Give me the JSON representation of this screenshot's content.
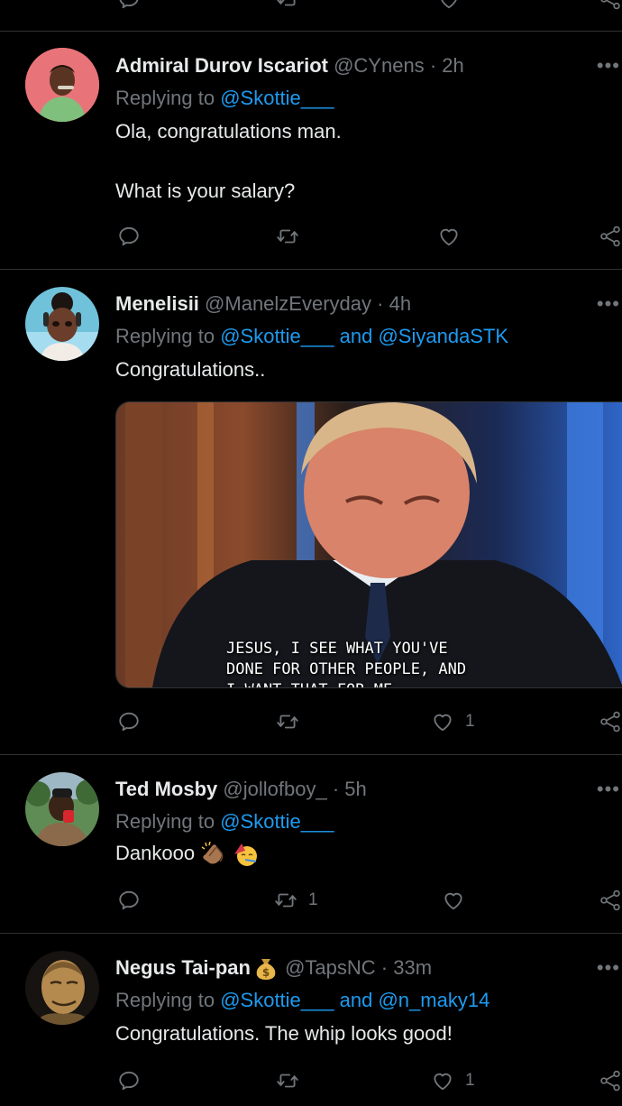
{
  "tweets": [
    {
      "name": "Admiral Durov Iscariot",
      "handle": "@CYnens",
      "dot": "·",
      "time": "2h",
      "replying_prefix": "Replying to",
      "mentions": [
        "@Skottie___"
      ],
      "text_lines": [
        "Ola, congratulations man.",
        "What is your salary?"
      ],
      "retweets": "",
      "likes": ""
    },
    {
      "name": "Menelisii",
      "handle": "@ManelzEveryday",
      "dot": "·",
      "time": "4h",
      "replying_prefix": "Replying to",
      "mentions": [
        "@Skottie___",
        "@SiyandaSTK"
      ],
      "conjunction": "and",
      "text_lines": [
        "Congratulations.."
      ],
      "media_caption": "JESUS, I SEE WHAT YOU'VE\nDONE FOR OTHER PEOPLE, AND\nI WANT THAT FOR ME.",
      "retweets": "",
      "likes": "1"
    },
    {
      "name": "Ted Mosby",
      "handle": "@jollofboy_",
      "dot": "·",
      "time": "5h",
      "replying_prefix": "Replying to",
      "mentions": [
        "@Skottie___"
      ],
      "text_lines": [
        "Dankooo"
      ],
      "retweets": "1",
      "likes": ""
    },
    {
      "name": "Negus Tai-pan",
      "handle": "@TapsNC",
      "dot": "·",
      "time": "33m",
      "replying_prefix": "Replying to",
      "mentions": [
        "@Skottie___",
        "@n_maky14"
      ],
      "conjunction": "and",
      "text_lines": [
        "Congratulations. The whip looks good!"
      ],
      "retweets": "",
      "likes": "1"
    }
  ],
  "more_glyph": "•••",
  "icons": [
    "reply-icon",
    "retweet-icon",
    "like-icon",
    "share-icon",
    "more-icon",
    "money-bag-emoji",
    "clapping-hands-emoji",
    "party-face-emoji"
  ],
  "colors": {
    "background": "#000000",
    "text": "#e7e9ea",
    "secondary": "#71767b",
    "link": "#1d9bf0",
    "divider": "#2f3336"
  }
}
